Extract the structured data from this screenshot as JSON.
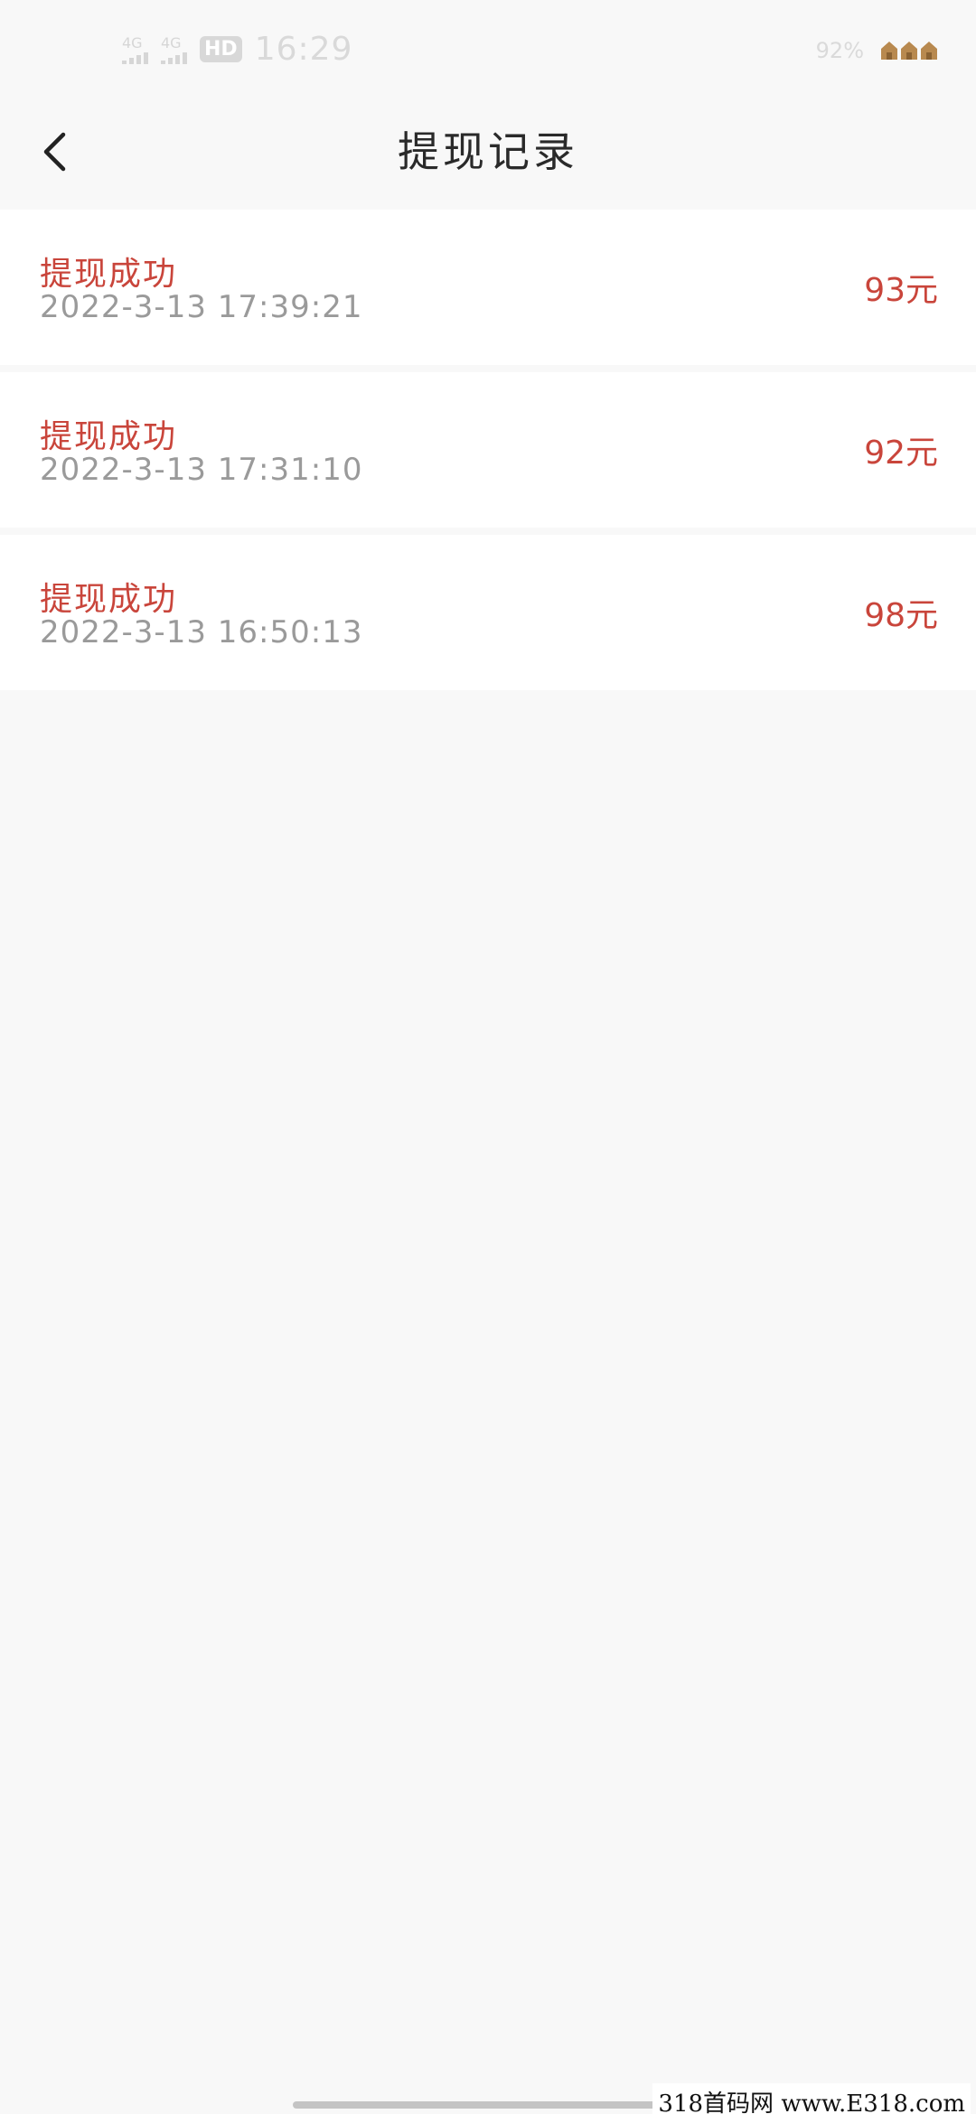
{
  "status_bar": {
    "network_1": "4G",
    "network_2": "4G",
    "hd_badge": "HD",
    "time": "16:29",
    "battery": "92%",
    "battery_icon": "house-battery-icon"
  },
  "nav": {
    "back_icon": "chevron-left-icon",
    "title": "提现记录"
  },
  "records": [
    {
      "status": "提现成功",
      "time": "2022-3-13 17:39:21",
      "amount": "93元"
    },
    {
      "status": "提现成功",
      "time": "2022-3-13 17:31:10",
      "amount": "92元"
    },
    {
      "status": "提现成功",
      "time": "2022-3-13 16:50:13",
      "amount": "98元"
    }
  ],
  "watermark": "318首码网 www.E318.com",
  "colors": {
    "accent": "#c9453b",
    "secondary_text": "#9a9a9a",
    "background": "#f8f8f8",
    "card": "#ffffff"
  }
}
